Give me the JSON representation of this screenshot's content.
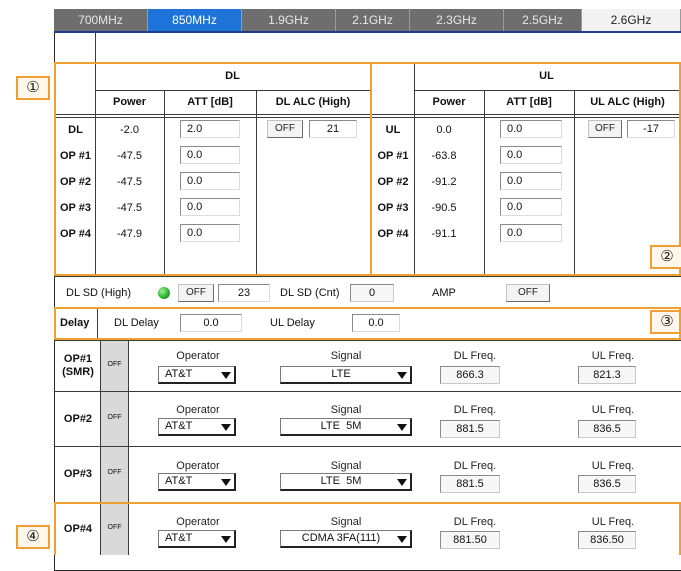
{
  "tabs": [
    "700MHz",
    "850MHz",
    "1.9GHz",
    "2.1GHz",
    "2.3GHz",
    "2.5GHz",
    "2.6GHz"
  ],
  "active_tab": "850MHz",
  "badges": {
    "b1": "①",
    "b2": "②",
    "b3": "③",
    "b4": "④"
  },
  "dl": {
    "title": "DL",
    "headers": {
      "power": "Power",
      "att": "ATT [dB]",
      "alc": "DL ALC (High)"
    },
    "rows": [
      {
        "label": "DL",
        "power": "-2.0",
        "att": "2.0"
      },
      {
        "label": "OP #1",
        "power": "-47.5",
        "att": "0.0"
      },
      {
        "label": "OP #2",
        "power": "-47.5",
        "att": "0.0"
      },
      {
        "label": "OP #3",
        "power": "-47.5",
        "att": "0.0"
      },
      {
        "label": "OP #4",
        "power": "-47.9",
        "att": "0.0"
      }
    ],
    "alc_button": "OFF",
    "alc_value": "21"
  },
  "ul": {
    "title": "UL",
    "headers": {
      "power": "Power",
      "att": "ATT [dB]",
      "alc": "UL ALC (High)"
    },
    "rows": [
      {
        "label": "UL",
        "power": "0.0",
        "att": "0.0"
      },
      {
        "label": "OP #1",
        "power": "-63.8",
        "att": "0.0"
      },
      {
        "label": "OP #2",
        "power": "-91.2",
        "att": "0.0"
      },
      {
        "label": "OP #3",
        "power": "-90.5",
        "att": "0.0"
      },
      {
        "label": "OP #4",
        "power": "-91.1",
        "att": "0.0"
      }
    ],
    "alc_button": "OFF",
    "alc_value": "-17"
  },
  "sd": {
    "dl_sd_high_label": "DL SD (High)",
    "dl_sd_high_button": "OFF",
    "dl_sd_high_value": "23",
    "dl_sd_cnt_label": "DL SD (Cnt)",
    "dl_sd_cnt_value": "0",
    "amp_label": "AMP",
    "amp_button": "OFF",
    "led_color": "#2bb52b"
  },
  "delay": {
    "label": "Delay",
    "dl_label": "DL Delay",
    "dl_value": "0.0",
    "ul_label": "UL Delay",
    "ul_value": "0.0"
  },
  "operators_headers": {
    "operator": "Operator",
    "signal": "Signal",
    "dl_freq": "DL Freq.",
    "ul_freq": "UL Freq."
  },
  "operators": [
    {
      "name": "OP#1",
      "sub": "(SMR)",
      "button": "OFF",
      "operator": "AT&T",
      "signal": "LTE",
      "dl_freq": "866.3",
      "ul_freq": "821.3"
    },
    {
      "name": "OP#2",
      "sub": "",
      "button": "OFF",
      "operator": "AT&T",
      "signal": "LTE  5M",
      "dl_freq": "881.5",
      "ul_freq": "836.5"
    },
    {
      "name": "OP#3",
      "sub": "",
      "button": "OFF",
      "operator": "AT&T",
      "signal": "LTE  5M",
      "dl_freq": "881.5",
      "ul_freq": "836.5"
    },
    {
      "name": "OP#4",
      "sub": "",
      "button": "OFF",
      "operator": "AT&T",
      "signal": "CDMA 3FA(111)",
      "dl_freq": "881.50",
      "ul_freq": "836.50"
    }
  ],
  "colors": {
    "accent": "#1e73d8",
    "highlight": "#f0a030",
    "tab_bg": "#6e6e6e"
  }
}
